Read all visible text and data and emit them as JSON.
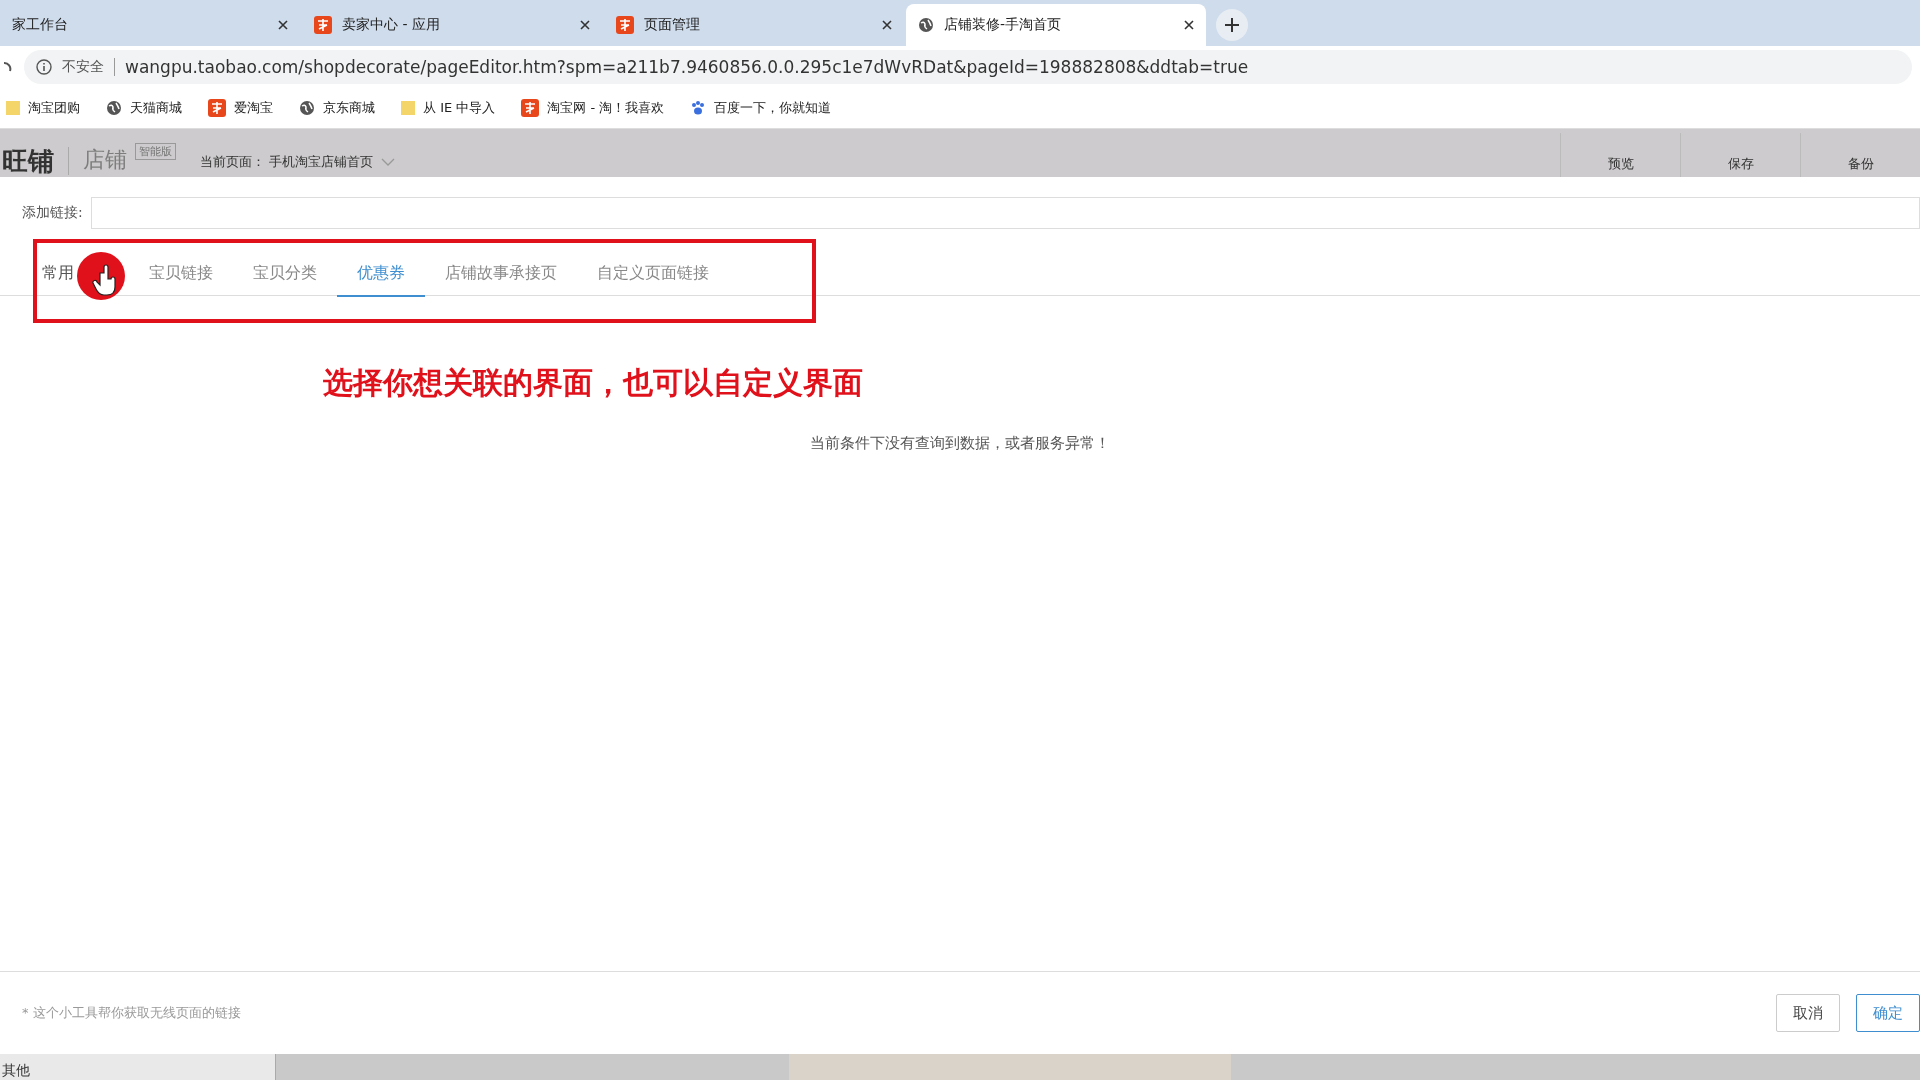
{
  "browser": {
    "tabs": [
      {
        "title": "家工作台",
        "kind": "plain",
        "selected": false
      },
      {
        "title": "卖家中心 - 应用",
        "kind": "taobao",
        "selected": false
      },
      {
        "title": "页面管理",
        "kind": "taobao",
        "selected": false
      },
      {
        "title": "店铺装修-手淘首页",
        "kind": "web",
        "selected": true
      }
    ],
    "security": "不安全",
    "url": "wangpu.taobao.com/shopdecorate/pageEditor.htm?spm=a211b7.9460856.0.0.295c1e7dWvRDat&pageId=198882808&ddtab=true",
    "bookmarks": [
      {
        "label": "淘宝团购",
        "kind": "folder"
      },
      {
        "label": "天猫商城",
        "kind": "web"
      },
      {
        "label": "爱淘宝",
        "kind": "taobao"
      },
      {
        "label": "京东商城",
        "kind": "web"
      },
      {
        "label": "从 IE 中导入",
        "kind": "folder"
      },
      {
        "label": "淘宝网 - 淘！我喜欢",
        "kind": "taobao"
      },
      {
        "label": "百度一下，你就知道",
        "kind": "baidu"
      }
    ]
  },
  "header": {
    "logo": "旺铺",
    "shop": "店铺",
    "badge": "智能版",
    "current_page": "当前页面： 手机淘宝店铺首页",
    "buttons": [
      "预览",
      "保存",
      "备份"
    ]
  },
  "dialog": {
    "link_label": "添加链接:",
    "tabs": [
      {
        "label": "常用",
        "selected": false
      },
      {
        "label": "宝贝链接",
        "selected": false
      },
      {
        "label": "宝贝分类",
        "selected": false
      },
      {
        "label": "优惠券",
        "selected": true
      },
      {
        "label": "店铺故事承接页",
        "selected": false
      },
      {
        "label": "自定义页面链接",
        "selected": false
      }
    ],
    "annotation": "选择你想关联的界面，也可以自定义界面",
    "empty_message": "当前条件下没有查询到数据，或者服务异常！",
    "footer_note": "* 这个小工具帮你获取无线页面的链接",
    "buttons": [
      {
        "label": "取消",
        "kind": "default"
      },
      {
        "label": "确定",
        "kind": "primary"
      }
    ]
  },
  "bottom": {
    "panel_label": "其他"
  }
}
